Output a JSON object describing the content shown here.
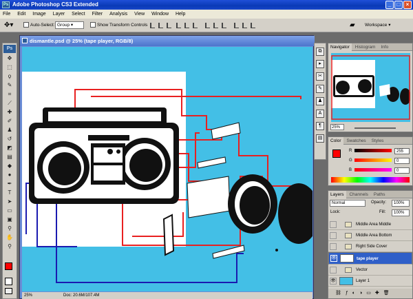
{
  "app": {
    "title": "Adobe Photoshop CS3 Extended",
    "logo": "Ps"
  },
  "window_buttons": {
    "minimize": "_",
    "maximize": "□",
    "close": "×"
  },
  "menu": [
    "File",
    "Edit",
    "Image",
    "Layer",
    "Select",
    "Filter",
    "Analysis",
    "View",
    "Window",
    "Help"
  ],
  "options": {
    "auto_select_label": "Auto-Select:",
    "auto_select_value": "Group",
    "show_transform_label": "Show Transform Controls",
    "workspace_label": "Workspace ▾"
  },
  "document": {
    "title": "dismantle.psd @ 25% (tape player, RGB/8)",
    "zoom": "25%",
    "doc_info": "Doc: 20.6M/107.4M"
  },
  "navigator": {
    "tabs": [
      "Navigator",
      "Histogram",
      "Info"
    ],
    "zoom": "25%"
  },
  "color_panel": {
    "tabs": [
      "Color",
      "Swatches",
      "Styles"
    ],
    "r_label": "R",
    "g_label": "G",
    "b_label": "B",
    "r": "255",
    "g": "0",
    "b": "0",
    "foreground": "#ff0000"
  },
  "layers_panel": {
    "tabs": [
      "Layers",
      "Channels",
      "Paths"
    ],
    "blend_mode": "Normal",
    "opacity_label": "Opacity:",
    "opacity": "100%",
    "lock_label": "Lock:",
    "fill_label": "Fill:",
    "fill": "100%",
    "layers": [
      {
        "name": "Middle Area Middle",
        "type": "folder"
      },
      {
        "name": "Middle Area Bottom",
        "type": "folder"
      },
      {
        "name": "Right Side Cover",
        "type": "folder"
      },
      {
        "name": "tape player",
        "type": "layer",
        "selected": true
      },
      {
        "name": "Vector",
        "type": "folder"
      },
      {
        "name": "Layer 1",
        "type": "layer"
      }
    ]
  },
  "colors": {
    "canvas": "#43bfe6",
    "guide_red": "#e82020",
    "guide_blue": "#1a1ab0",
    "selection": "#2f5fc8"
  }
}
